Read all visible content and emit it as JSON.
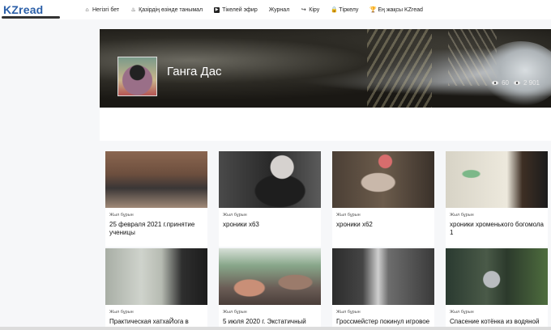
{
  "logo": {
    "text": "KZread"
  },
  "nav": [
    {
      "label": "Негізгі бет",
      "icon": "home-icon"
    },
    {
      "label": "Қазірдің өзінде танымал",
      "icon": "flame-icon"
    },
    {
      "label": "Тікелей эфир",
      "icon": "youtube-icon"
    },
    {
      "label": "Журнал",
      "icon": ""
    },
    {
      "label": "Кіру",
      "icon": "login-icon"
    },
    {
      "label": "Тіркелу",
      "icon": "lock-icon"
    },
    {
      "label": "Ең жақсы KZread",
      "icon": "trophy-icon"
    }
  ],
  "channel": {
    "name": "Ганга Дас",
    "likes": "60",
    "views": "2 901"
  },
  "videos": [
    {
      "age": "Жыл бұрын",
      "title": "25 февраля 2021 г.принятие ученицы"
    },
    {
      "age": "Жыл бұрын",
      "title": "хроники х63"
    },
    {
      "age": "Жыл бұрын",
      "title": "хроники х62"
    },
    {
      "age": "Жыл бұрын",
      "title": "хроники хроменького богомола 1"
    },
    {
      "age": "Жыл бұрын",
      "title": "Практическая хатхаЙога в"
    },
    {
      "age": "Жыл бұрын",
      "title": "5 июля 2020 г. Экстатичный"
    },
    {
      "age": "Жыл бұрын",
      "title": "Гроссмейстер покинул игровое"
    },
    {
      "age": "Жыл бұрын",
      "title": "Спасение котёнка из водяной"
    }
  ]
}
